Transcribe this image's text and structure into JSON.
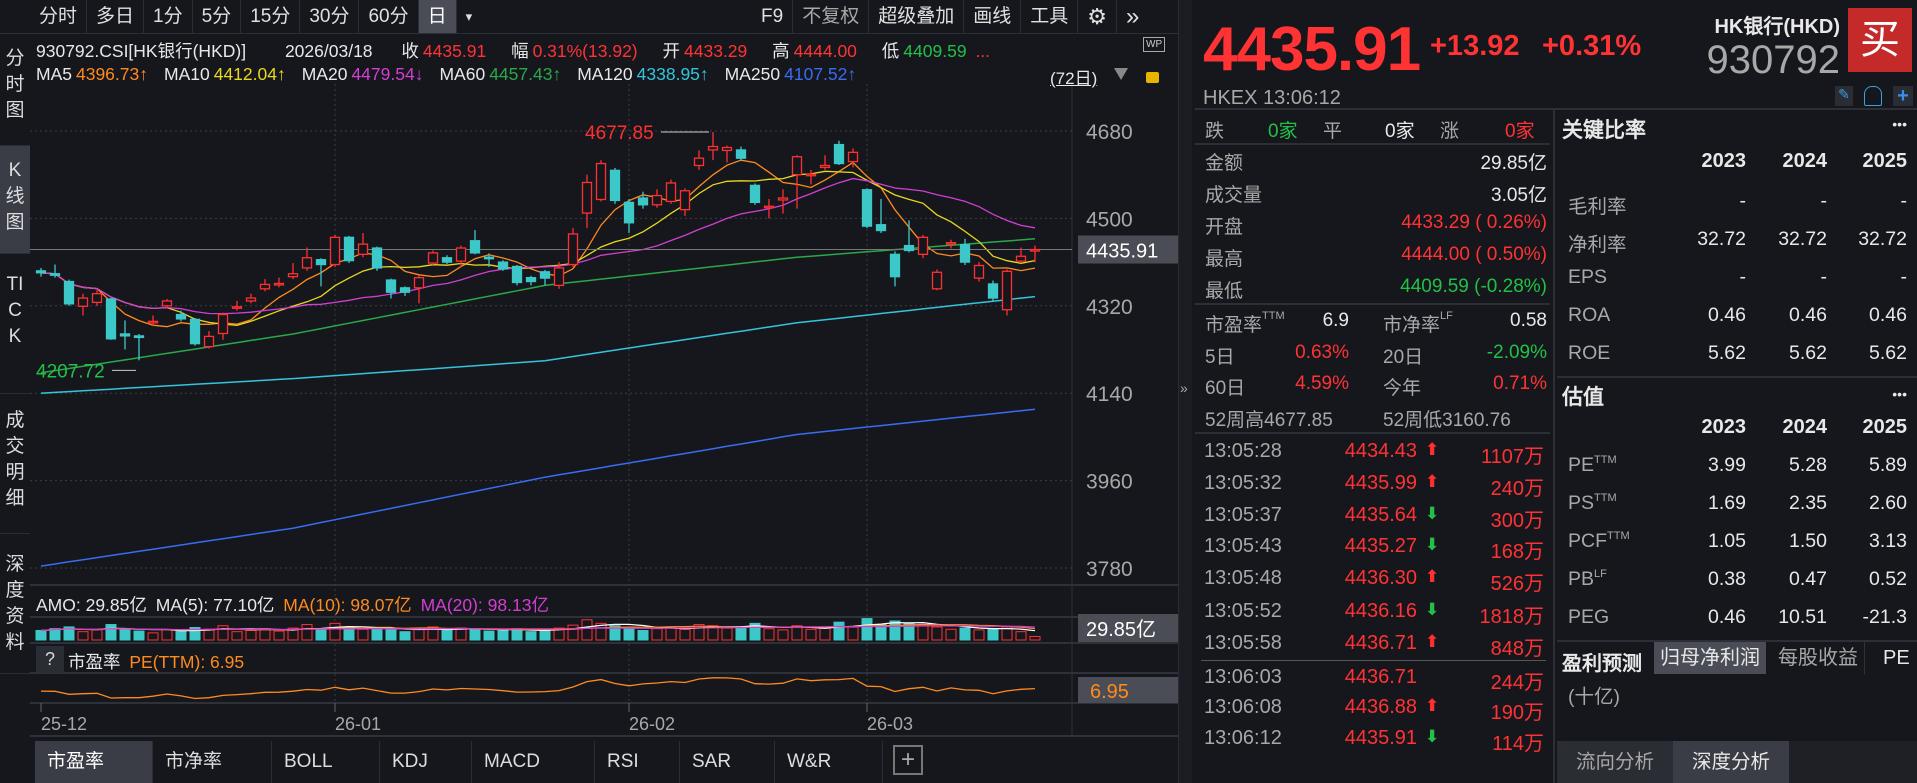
{
  "toolbar": {
    "periods": [
      "分时",
      "多日",
      "1分",
      "5分",
      "15分",
      "30分",
      "60分",
      "日"
    ],
    "dropdown": "▾",
    "right": [
      "F9",
      "不复权",
      "超级叠加",
      "画线",
      "工具"
    ],
    "gear": "⚙",
    "more": "»"
  },
  "side_tabs": [
    "分时图",
    "K线图",
    "TICK",
    "成交明细",
    "深度资料"
  ],
  "info": {
    "code": "930792.CSI[HK银行(HKD)]",
    "date": "2026/03/18",
    "close_label": "收",
    "close": "4435.91",
    "amp_label": "幅",
    "amp": "0.31%(13.92)",
    "open_label": "开",
    "open": "4433.29",
    "high_label": "高",
    "high": "4444.00",
    "low_label": "低",
    "low": "4409.59",
    "more": "...",
    "wp": "WP"
  },
  "ma_legend": [
    {
      "label": "MA5",
      "value": "4396.73↑",
      "color": "#ff8a1e"
    },
    {
      "label": "MA10",
      "value": "4412.04↑",
      "color": "#e8d81e"
    },
    {
      "label": "MA20",
      "value": "4479.54↓",
      "color": "#d23fd2"
    },
    {
      "label": "MA60",
      "value": "4457.43↑",
      "color": "#2aa84a"
    },
    {
      "label": "MA120",
      "value": "4338.95↑",
      "color": "#35c4dc"
    },
    {
      "label": "MA250",
      "value": "4107.52↑",
      "color": "#3a6cf0"
    }
  ],
  "ma_days": "(72日)",
  "amo_legend": {
    "amo": "AMO: 29.85亿",
    "ma5": "MA(5): 77.10亿",
    "ma10": "MA(10): 98.07亿",
    "ma20": "MA(20): 98.13亿"
  },
  "pe_legend": {
    "help": "?",
    "name": "市盈率",
    "value": "PE(TTM): 6.95"
  },
  "bottom_tabs": [
    "市盈率",
    "市净率",
    "BOLL",
    "KDJ",
    "MACD",
    "RSI",
    "SAR",
    "W&R",
    "+"
  ],
  "chart_data": {
    "type": "candlestick",
    "candle_fields": [
      "open",
      "close",
      "high",
      "low"
    ],
    "candles": [
      [
        4392,
        4388,
        4398,
        4380
      ],
      [
        4386,
        4384,
        4405,
        4378
      ],
      [
        4370,
        4324,
        4374,
        4320
      ],
      [
        4319,
        4336,
        4345,
        4300
      ],
      [
        4327,
        4345,
        4352,
        4320
      ],
      [
        4334,
        4252,
        4336,
        4250
      ],
      [
        4262,
        4258,
        4290,
        4230
      ],
      [
        4258,
        4257,
        4262,
        4207.72
      ],
      [
        4286,
        4288,
        4300,
        4278
      ],
      [
        4320,
        4330,
        4334,
        4316
      ],
      [
        4302,
        4293,
        4310,
        4288
      ],
      [
        4292,
        4242,
        4295,
        4238
      ],
      [
        4236,
        4257,
        4268,
        4232
      ],
      [
        4263,
        4302,
        4306,
        4250
      ],
      [
        4315,
        4318,
        4330,
        4310
      ],
      [
        4330,
        4336,
        4345,
        4325
      ],
      [
        4355,
        4364,
        4375,
        4350
      ],
      [
        4365,
        4366,
        4378,
        4358
      ],
      [
        4380,
        4386,
        4408,
        4375
      ],
      [
        4398,
        4419,
        4440,
        4392
      ],
      [
        4415,
        4405,
        4418,
        4360
      ],
      [
        4405,
        4461,
        4466,
        4400
      ],
      [
        4461,
        4413,
        4464,
        4408
      ],
      [
        4426,
        4447,
        4470,
        4420
      ],
      [
        4439,
        4398,
        4442,
        4392
      ],
      [
        4373,
        4348,
        4376,
        4335
      ],
      [
        4357,
        4348,
        4360,
        4340
      ],
      [
        4357,
        4378,
        4382,
        4325
      ],
      [
        4408,
        4429,
        4434,
        4404
      ],
      [
        4419,
        4410,
        4424,
        4406
      ],
      [
        4412,
        4439,
        4444,
        4400
      ],
      [
        4454,
        4429,
        4476,
        4426
      ],
      [
        4420,
        4418,
        4428,
        4400
      ],
      [
        4410,
        4396,
        4414,
        4392
      ],
      [
        4401,
        4368,
        4404,
        4362
      ],
      [
        4378,
        4370,
        4382,
        4362
      ],
      [
        4390,
        4377,
        4394,
        4362
      ],
      [
        4362,
        4398,
        4410,
        4355
      ],
      [
        4405,
        4468,
        4480,
        4400
      ],
      [
        4511,
        4574,
        4590,
        4480
      ],
      [
        4539,
        4613,
        4620,
        4535
      ],
      [
        4599,
        4537,
        4604,
        4530
      ],
      [
        4533,
        4491,
        4540,
        4470
      ],
      [
        4542,
        4528,
        4555,
        4520
      ],
      [
        4528,
        4547,
        4560,
        4522
      ],
      [
        4535,
        4573,
        4580,
        4530
      ],
      [
        4518,
        4557,
        4562,
        4505
      ],
      [
        4609,
        4624,
        4640,
        4600
      ],
      [
        4641,
        4648,
        4677.85,
        4620
      ],
      [
        4640,
        4646,
        4650,
        4615
      ],
      [
        4641,
        4624,
        4648,
        4618
      ],
      [
        4568,
        4533,
        4572,
        4528
      ],
      [
        4522,
        4525,
        4540,
        4500
      ],
      [
        4538,
        4542,
        4560,
        4510
      ],
      [
        4590,
        4627,
        4630,
        4520
      ],
      [
        4588,
        4591,
        4600,
        4570
      ],
      [
        4605,
        4609,
        4630,
        4600
      ],
      [
        4652,
        4613,
        4660,
        4610
      ],
      [
        4617,
        4636,
        4644,
        4605
      ],
      [
        4559,
        4484,
        4562,
        4480
      ],
      [
        4487,
        4475,
        4540,
        4470
      ],
      [
        4426,
        4380,
        4432,
        4360
      ],
      [
        4444,
        4434,
        4496,
        4430
      ],
      [
        4426,
        4461,
        4466,
        4418
      ],
      [
        4355,
        4389,
        4395,
        4352
      ],
      [
        4447,
        4450,
        4456,
        4438
      ],
      [
        4446,
        4410,
        4458,
        4404
      ],
      [
        4377,
        4403,
        4410,
        4370
      ],
      [
        4365,
        4336,
        4372,
        4330
      ],
      [
        4312,
        4391,
        4395,
        4300
      ],
      [
        4412,
        4422,
        4440,
        4408
      ],
      [
        4433.29,
        4435.91,
        4444.0,
        4409.59
      ]
    ],
    "amount": [
      80,
      95,
      110,
      70,
      85,
      130,
      90,
      75,
      60,
      88,
      72,
      105,
      92,
      120,
      70,
      80,
      95,
      75,
      100,
      130,
      85,
      140,
      110,
      90,
      100,
      85,
      70,
      95,
      110,
      80,
      100,
      90,
      75,
      85,
      95,
      70,
      80,
      100,
      125,
      170,
      140,
      120,
      100,
      80,
      95,
      110,
      90,
      130,
      120,
      100,
      110,
      140,
      95,
      85,
      120,
      90,
      100,
      150,
      110,
      180,
      130,
      160,
      140,
      120,
      110,
      90,
      100,
      85,
      95,
      110,
      70,
      29.85
    ],
    "long_ma": [
      {
        "name": "MA60",
        "color": "#2aa84a",
        "points": [
          [
            0,
            4182
          ],
          [
            18,
            4262
          ],
          [
            36,
            4362
          ],
          [
            54,
            4420
          ],
          [
            71,
            4458
          ]
        ]
      },
      {
        "name": "MA120",
        "color": "#35c4dc",
        "points": [
          [
            0,
            4140
          ],
          [
            18,
            4170
          ],
          [
            36,
            4207
          ],
          [
            54,
            4285
          ],
          [
            71,
            4339
          ]
        ]
      },
      {
        "name": "MA250",
        "color": "#3a6cf0",
        "points": [
          [
            0,
            3784
          ],
          [
            18,
            3862
          ],
          [
            36,
            3967
          ],
          [
            54,
            4055
          ],
          [
            71,
            4107
          ]
        ]
      }
    ],
    "y_ticks": [
      "4680",
      "4500",
      "4320",
      "4140",
      "3960",
      "3780"
    ],
    "y_range": [
      3780,
      4680
    ],
    "x_ticks": [
      {
        "label": "25-12",
        "index": 0
      },
      {
        "label": "26-01",
        "index": 21
      },
      {
        "label": "26-02",
        "index": 42
      },
      {
        "label": "26-03",
        "index": 59
      }
    ],
    "high_mark": {
      "label": "4677.85",
      "index": 48
    },
    "low_mark": {
      "label": "4207.72",
      "index": 7
    },
    "last_price_label": "4435.91",
    "amount_label": "29.85亿",
    "pe_label": "6.95",
    "pe_last": 6.95
  },
  "quote": {
    "price": "4435.91",
    "change": "+13.92",
    "pct": "+0.31%",
    "name": "HK银行(HKD)",
    "code": "930792",
    "buy": "买",
    "exchange": "HKEX",
    "time": "13:06:12",
    "breadth": [
      {
        "label": "跌",
        "value": "0家"
      },
      {
        "label": "平",
        "value": "0家"
      },
      {
        "label": "涨",
        "value": "0家"
      }
    ],
    "stats": [
      {
        "label": "金额",
        "value": "29.85亿"
      },
      {
        "label": "成交量",
        "value": "3.05亿"
      },
      {
        "label": "开盘",
        "value": "4433.29 ( 0.26%)"
      },
      {
        "label": "最高",
        "value": "4444.00 ( 0.50%)"
      },
      {
        "label": "最低",
        "value": "4409.59 (-0.28%)"
      }
    ],
    "pe_label": "市盈率",
    "pe_sup": "TTM",
    "pe": "6.9",
    "pb_label": "市净率",
    "pb_sup": "LF",
    "pb": "0.58",
    "d5_label": "5日",
    "d5": "0.63%",
    "d20_label": "20日",
    "d20": "-2.09%",
    "d60_label": "60日",
    "d60": "4.59%",
    "ytd_label": "今年",
    "ytd": "0.71%",
    "w52h_label": "52周高",
    "w52h": "4677.85",
    "w52l_label": "52周低",
    "w52l": "3160.76"
  },
  "ticks": [
    {
      "time": "13:05:28",
      "price": "4434.43",
      "dir": "up",
      "vol": "1107万"
    },
    {
      "time": "13:05:32",
      "price": "4435.99",
      "dir": "up",
      "vol": "240万"
    },
    {
      "time": "13:05:37",
      "price": "4435.64",
      "dir": "down",
      "vol": "300万"
    },
    {
      "time": "13:05:43",
      "price": "4435.27",
      "dir": "down",
      "vol": "168万"
    },
    {
      "time": "13:05:48",
      "price": "4436.30",
      "dir": "up",
      "vol": "526万"
    },
    {
      "time": "13:05:52",
      "price": "4436.16",
      "dir": "down",
      "vol": "1818万"
    },
    {
      "time": "13:05:58",
      "price": "4436.71",
      "dir": "up",
      "vol": "848万"
    },
    {
      "time": "13:06:03",
      "price": "4436.71",
      "dir": "",
      "vol": "244万"
    },
    {
      "time": "13:06:08",
      "price": "4436.88",
      "dir": "up",
      "vol": "190万"
    },
    {
      "time": "13:06:12",
      "price": "4435.91",
      "dir": "down",
      "vol": "114万"
    }
  ],
  "ratios": {
    "title": "关键比率",
    "more": "•••",
    "years": [
      "2023",
      "2024",
      "2025"
    ],
    "rows": [
      {
        "label": "毛利率",
        "v": [
          "-",
          "-",
          "-"
        ]
      },
      {
        "label": "净利率",
        "v": [
          "32.72",
          "32.72",
          "32.72"
        ]
      },
      {
        "label": "EPS",
        "v": [
          "-",
          "-",
          "-"
        ]
      },
      {
        "label": "ROA",
        "v": [
          "0.46",
          "0.46",
          "0.46"
        ]
      },
      {
        "label": "ROE",
        "v": [
          "5.62",
          "5.62",
          "5.62"
        ]
      }
    ]
  },
  "valuation": {
    "title": "估值",
    "more": "•••",
    "years": [
      "2023",
      "2024",
      "2025"
    ],
    "rows": [
      {
        "label": "PE",
        "sup": "TTM",
        "v": [
          "3.99",
          "5.28",
          "5.89"
        ]
      },
      {
        "label": "PS",
        "sup": "TTM",
        "v": [
          "1.69",
          "2.35",
          "2.60"
        ]
      },
      {
        "label": "PCF",
        "sup": "TTM",
        "v": [
          "1.05",
          "1.50",
          "3.13"
        ]
      },
      {
        "label": "PB",
        "sup": "LF",
        "v": [
          "0.38",
          "0.47",
          "0.52"
        ]
      },
      {
        "label": "PEG",
        "sup": "",
        "v": [
          "0.46",
          "10.51",
          "-21.3"
        ]
      }
    ]
  },
  "forecast": {
    "title": "盈利预测",
    "tabs": [
      "归母净利润",
      "每股收益",
      "PE"
    ],
    "unit": "(十亿)"
  },
  "right_bottom_tabs": [
    "流向分析",
    "深度分析"
  ]
}
